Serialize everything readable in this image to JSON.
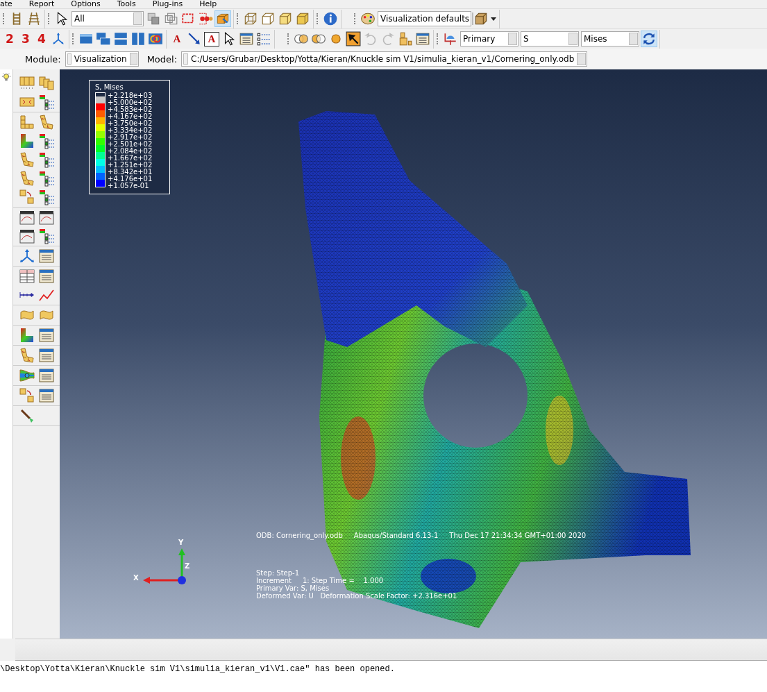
{
  "menu": [
    "ate",
    "Report",
    "Options",
    "Tools",
    "Plug-ins",
    "Help"
  ],
  "toolbar": {
    "selection_filter": "All",
    "view_manager": "Visualization defaults",
    "view_numbers": [
      "2",
      "3",
      "4"
    ],
    "text_tool_letters": [
      "A",
      "A"
    ],
    "field_output": [
      "Primary",
      "S",
      "Mises"
    ]
  },
  "context_bar": {
    "module_label": "Module:",
    "module": "Visualization",
    "model_label": "Model:",
    "model": "C:/Users/Grubar/Desktop/Yotta/Kieran/Knuckle sim V1/simulia_kieran_v1/Cornering_only.odb"
  },
  "legend": {
    "title": "S, Mises",
    "ticks": [
      "+2.218e+03",
      "+5.000e+02",
      "+4.583e+02",
      "+4.167e+02",
      "+3.750e+02",
      "+3.334e+02",
      "+2.917e+02",
      "+2.501e+02",
      "+2.084e+02",
      "+1.667e+02",
      "+1.251e+02",
      "+8.342e+01",
      "+4.176e+01",
      "+1.057e-01"
    ],
    "bands": [
      {
        "color": "#c8c8c8"
      },
      {
        "color": "#ff0000"
      },
      {
        "color": "#ff5c00"
      },
      {
        "color": "#ffb400"
      },
      {
        "color": "#e6ff00"
      },
      {
        "color": "#96ff00"
      },
      {
        "color": "#32ff00"
      },
      {
        "color": "#00ff28"
      },
      {
        "color": "#00ff94"
      },
      {
        "color": "#00ffe6"
      },
      {
        "color": "#00c0ff"
      },
      {
        "color": "#0064ff"
      },
      {
        "color": "#0000ff"
      }
    ]
  },
  "triad": {
    "x": "X",
    "y": "Y",
    "z": "Z"
  },
  "viewport_info": {
    "header": [
      "ODB: Cornering_only.odb",
      "Abaqus/Standard 6.13-1",
      "Thu Dec 17 21:34:34 GMT+01:00 2020"
    ],
    "lines": [
      "Step: Step-1",
      "Increment     1: Step Time =    1.000",
      "Primary Var: S, Mises",
      "Deformed Var: U   Deformation Scale Factor: +2.316e+01"
    ]
  },
  "message": "\\Desktop\\Yotta\\Kieran\\Knuckle sim V1\\simulia_kieran_v1\\V1.cae\" has been opened."
}
